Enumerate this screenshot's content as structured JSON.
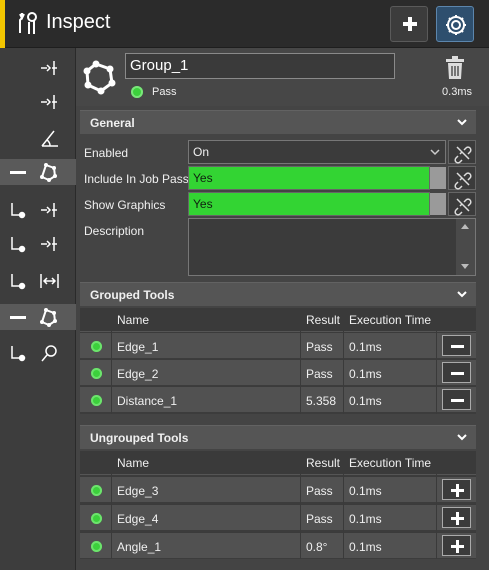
{
  "header": {
    "title": "Inspect",
    "accent_color": "#f2c500"
  },
  "sidebar": {
    "items": [
      {
        "icon": "edge-icon",
        "selected": false
      },
      {
        "icon": "edge-icon",
        "selected": false
      },
      {
        "icon": "angle-icon",
        "selected": false
      },
      {
        "icon": "group-icon",
        "selected": true
      },
      {
        "icon": "edge-icon",
        "selected": false
      },
      {
        "icon": "edge-icon",
        "selected": false
      },
      {
        "icon": "distance-icon",
        "selected": false
      },
      {
        "icon": "group-icon",
        "selected": true
      },
      {
        "icon": "search-icon",
        "selected": false
      }
    ]
  },
  "tool": {
    "name": "Group_1",
    "status": "Pass",
    "time": "0.3ms"
  },
  "general": {
    "heading": "General",
    "enabled_label": "Enabled",
    "enabled_value": "On",
    "include_label": "Include In Job Pass",
    "include_value": "Yes",
    "show_label": "Show Graphics",
    "show_value": "Yes",
    "description_label": "Description"
  },
  "grouped": {
    "heading": "Grouped Tools",
    "columns": [
      "Name",
      "Result",
      "Execution Time"
    ],
    "rows": [
      {
        "name": "Edge_1",
        "result": "Pass",
        "time": "0.1ms"
      },
      {
        "name": "Edge_2",
        "result": "Pass",
        "time": "0.1ms"
      },
      {
        "name": "Distance_1",
        "result": "5.358",
        "time": "0.1ms"
      }
    ]
  },
  "ungrouped": {
    "heading": "Ungrouped Tools",
    "columns": [
      "Name",
      "Result",
      "Execution Time"
    ],
    "rows": [
      {
        "name": "Edge_3",
        "result": "Pass",
        "time": "0.1ms"
      },
      {
        "name": "Edge_4",
        "result": "Pass",
        "time": "0.1ms"
      },
      {
        "name": "Angle_1",
        "result": "0.8°",
        "time": "0.1ms"
      }
    ]
  },
  "colors": {
    "pass_green": "#3cd13c",
    "field_green": "#33d433"
  }
}
